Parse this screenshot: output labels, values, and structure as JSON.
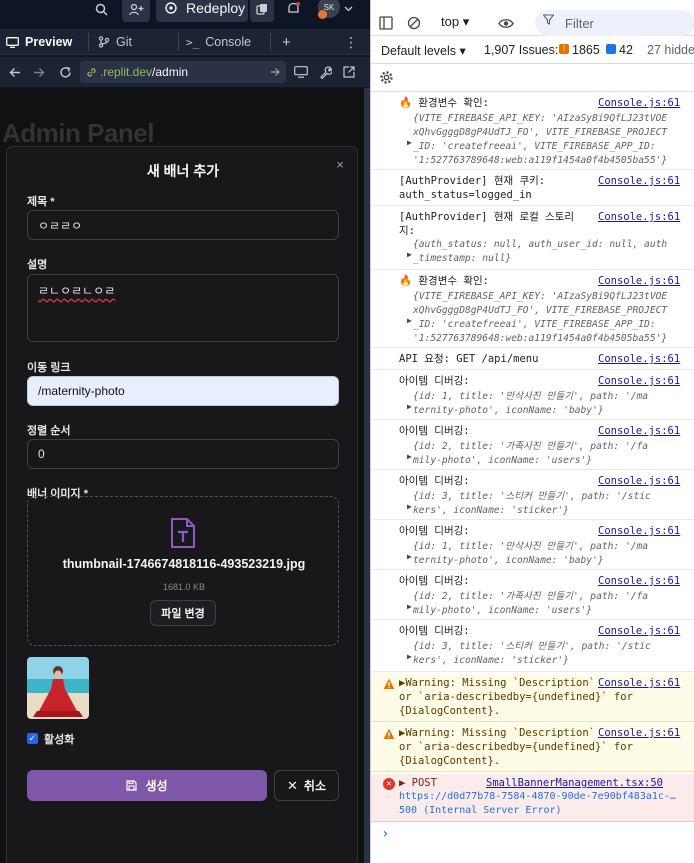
{
  "replit": {
    "redeploy_label": "Redeploy",
    "avatar_initials": "SK",
    "tabs": [
      {
        "icon": "preview-icon",
        "label": "Preview"
      },
      {
        "icon": "git-icon",
        "label": "Git"
      },
      {
        "icon": "console-icon",
        "label": "Console"
      }
    ],
    "new_tab_label": "+",
    "tab_menu_label": "⋮",
    "url_domain": ".replit.dev",
    "url_path": "/admin",
    "background_title": "Admin Panel"
  },
  "modal": {
    "title": "새 배너 추가",
    "close_label": "×",
    "title_field": {
      "label": "제목 *",
      "value": "ㅇㄹㄹㅇ"
    },
    "description_field": {
      "label": "설명",
      "value": "ㄹㄴㅇㄹㄴㅇㄹ"
    },
    "link_field": {
      "label": "이동 링크",
      "value": "/maternity-photo"
    },
    "order_field": {
      "label": "정렬 순서",
      "value": "0"
    },
    "image_section": {
      "label": "배너 이미지 *",
      "file_name": "thumbnail-1746674818116-493523219.jpg",
      "file_size": "1681.0 KB",
      "change_button": "파일 변경"
    },
    "active_checkbox": {
      "label": "활성화",
      "checked": true
    },
    "create_button": "생성",
    "cancel_button": "취소"
  },
  "devtools": {
    "context": "top",
    "filter_placeholder": "Filter",
    "levels_label": "Default levels ▾",
    "issues_label": "1,907 Issues:",
    "issues_error_count": "1865",
    "issues_info_count": "42",
    "hidden_label": "27 hidde",
    "logs": [
      {
        "type": "info",
        "message": "🔥 환경변수 확인:",
        "source": "Console.js:61",
        "details": "{VITE_FIREBASE_API_KEY: 'AIzaSyBi9QfLJ23tVOE\nxQhvGgggD8gP4UdTJ_FO', VITE_FIREBASE_PROJECT\n_ID: 'createfreeai', VITE_FIREBASE_APP_ID:\n'1:527763789648:web:a119f1454a0f4b4505ba55'}"
      },
      {
        "type": "info",
        "message": "[AuthProvider] 현재 쿠키:\nauth_status=logged_in",
        "source": "Console.js:61",
        "details": ""
      },
      {
        "type": "info",
        "message": "[AuthProvider] 현재 로컬 스토리\n지:",
        "source": "Console.js:61",
        "details": "{auth_status: null, auth_user_id: null, auth\n_timestamp: null}"
      },
      {
        "type": "info",
        "message": "🔥 환경변수 확인:",
        "source": "Console.js:61",
        "details": "{VITE_FIREBASE_API_KEY: 'AIzaSyBi9QfLJ23tVOE\nxQhvGgggD8gP4UdTJ_FO', VITE_FIREBASE_PROJECT\n_ID: 'createfreeai', VITE_FIREBASE_APP_ID:\n'1:527763789648:web:a119f1454a0f4b4505ba55'}"
      },
      {
        "type": "info",
        "message": "API 요청: GET /api/menu",
        "source": "Console.js:61",
        "details": ""
      },
      {
        "type": "info",
        "message": "아이템 디버깅:",
        "source": "Console.js:61",
        "details": "{id: 1, title: '만삭사진 만들기', path: '/ma\nternity-photo', iconName: 'baby'}"
      },
      {
        "type": "info",
        "message": "아이템 디버깅:",
        "source": "Console.js:61",
        "details": "{id: 2, title: '가족사진 만들기', path: '/fa\nmily-photo', iconName: 'users'}"
      },
      {
        "type": "info",
        "message": "아이템 디버깅:",
        "source": "Console.js:61",
        "details": "{id: 3, title: '스티커 만들기', path: '/stic\nkers', iconName: 'sticker'}"
      },
      {
        "type": "info",
        "message": "아이템 디버깅:",
        "source": "Console.js:61",
        "details": "{id: 1, title: '만삭사진 만들기', path: '/ma\nternity-photo', iconName: 'baby'}"
      },
      {
        "type": "info",
        "message": "아이템 디버깅:",
        "source": "Console.js:61",
        "details": "{id: 2, title: '가족사진 만들기', path: '/fa\nmily-photo', iconName: 'users'}"
      },
      {
        "type": "info",
        "message": "아이템 디버깅:",
        "source": "Console.js:61",
        "details": "{id: 3, title: '스티커 만들기', path: '/stic\nkers', iconName: 'sticker'}"
      },
      {
        "type": "warning",
        "message": "▶Warning: Missing `Description`\nor `aria-describedby={undefined}` for\n{DialogContent}.",
        "source": "Console.js:61",
        "details": ""
      },
      {
        "type": "warning",
        "message": "▶Warning: Missing `Description`\nor `aria-describedby={undefined}` for\n{DialogContent}.",
        "source": "Console.js:61",
        "details": ""
      },
      {
        "type": "error",
        "message": "▶ POST",
        "source": "SmallBannerManagement.tsx:50",
        "details": "https://d0d77b78-7584-4870-90de-7e90bf483a1c-…\n500 (Internal Server Error)"
      }
    ],
    "prompt_symbol": "›"
  },
  "colors": {
    "replit_bg": "#0e1525",
    "modal_bg": "#18181b",
    "create_button": "#7e57a8",
    "checkbox": "#2563eb",
    "console_link": "#1a1aa6",
    "console_string": "#c80000",
    "warning_bg": "#fefbe7",
    "error_bg": "#fcebeb"
  }
}
